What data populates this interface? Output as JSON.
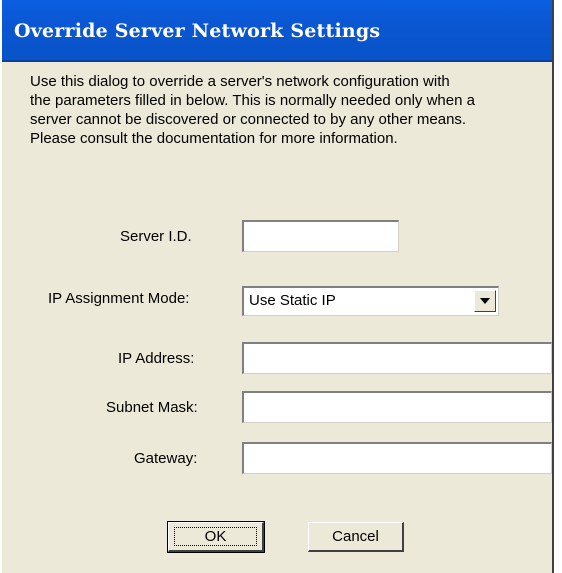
{
  "dialog": {
    "title": "Override Server Network Settings",
    "description_lines": [
      "Use this dialog to override a server's network configuration with",
      "the parameters filled in below. This is normally needed only when a",
      "server cannot be discovered or connected to by any other means.",
      "Please consult the documentation for more information."
    ],
    "title_color": "#0a5ee0",
    "background_color": "#ece9d8"
  },
  "form": {
    "server_id": {
      "label": "Server I.D.",
      "value": ""
    },
    "ip_mode": {
      "label": "IP Assignment Mode:",
      "value": "Use Static IP",
      "icon": "chevron-down-icon"
    },
    "ip_address": {
      "label": "IP Address:",
      "value": ""
    },
    "subnet_mask": {
      "label": "Subnet Mask:",
      "value": ""
    },
    "gateway": {
      "label": "Gateway:",
      "value": ""
    }
  },
  "buttons": {
    "ok_label": "OK",
    "cancel_label": "Cancel"
  }
}
